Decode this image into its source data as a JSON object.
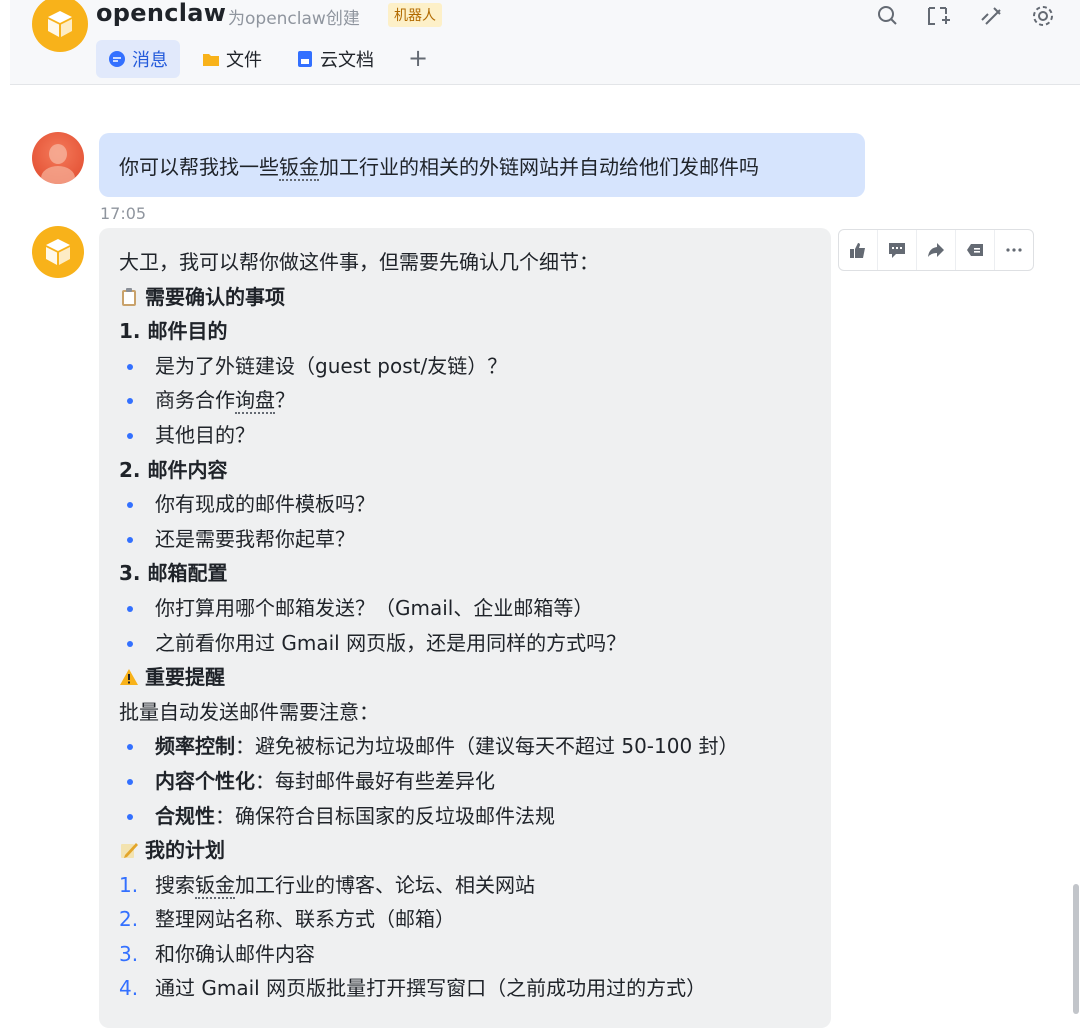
{
  "header": {
    "title": "openclaw",
    "subtitle": "为openclaw创建",
    "badge": "机器人",
    "tabs": [
      {
        "label": "消息",
        "icon": "message-icon",
        "active": true
      },
      {
        "label": "文件",
        "icon": "folder-icon",
        "active": false
      },
      {
        "label": "云文档",
        "icon": "doc-icon",
        "active": false
      }
    ],
    "add_tab": "+",
    "icons": [
      "search-icon",
      "add-member-icon",
      "pin-icon",
      "settings-icon"
    ]
  },
  "messages": {
    "user": {
      "pre": "你可以帮我找一些",
      "underlined": "钣金",
      "post": "加工行业的相关的外链网站并自动给他们发邮件吗"
    },
    "timestamp": "17:05",
    "reply": {
      "intro": "大卫，我可以帮你做这件事，但需要先确认几个细节：",
      "section1_title": "需要确认的事项",
      "q1_title": "1. 邮件目的",
      "q1_items": [
        "是为了外链建设（guest post/友链）？",
        "商务合作",
        "询盘",
        "？",
        "其他目的？"
      ],
      "q2_title": "2. 邮件内容",
      "q2_items": [
        "你有现成的邮件模板吗？",
        "还是需要我帮你起草？"
      ],
      "q3_title": "3. 邮箱配置",
      "q3_items": [
        "你打算用哪个邮箱发送？（Gmail、企业邮箱等）",
        "之前看你用过 Gmail 网页版，还是用同样的方式吗？"
      ],
      "section2_title": "重要提醒",
      "reminder_intro": "批量自动发送邮件需要注意：",
      "reminders": [
        {
          "bold": "频率控制",
          "text": "：避免被标记为垃圾邮件（建议每天不超过 50-100 封）"
        },
        {
          "bold": "内容个性化",
          "text": "：每封邮件最好有些差异化"
        },
        {
          "bold": "合规性",
          "text": "：确保符合目标国家的反垃圾邮件法规"
        }
      ],
      "section3_title": "我的计划",
      "plan": [
        {
          "n": "1.",
          "pre": "搜索",
          "u": "钣金",
          "post": "加工行业的博客、论坛、相关网站"
        },
        {
          "n": "2.",
          "pre": "整理网站名称、联系方式（邮箱）",
          "u": "",
          "post": ""
        },
        {
          "n": "3.",
          "pre": "和你确认邮件内容",
          "u": "",
          "post": ""
        },
        {
          "n": "4.",
          "pre": "通过 Gmail 网页版批量打开撰写窗口（之前成功用过的方式）",
          "u": "",
          "post": ""
        }
      ]
    }
  },
  "actions": [
    "thumbs-up-icon",
    "comment-icon",
    "forward-icon",
    "quote-icon",
    "more-icon"
  ]
}
